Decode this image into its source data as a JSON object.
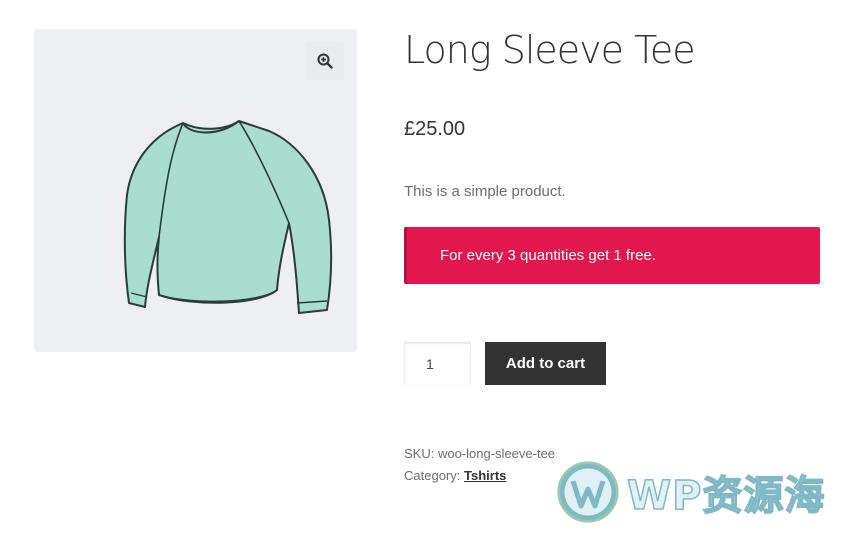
{
  "product": {
    "title": "Long Sleeve Tee",
    "price": "£25.00",
    "description": "This is a simple product.",
    "notice": "For every 3 quantities get 1 free.",
    "quantity": "1",
    "add_to_cart_label": "Add to cart",
    "sku_label": "SKU:",
    "sku_value": "woo-long-sleeve-tee",
    "category_label": "Category:",
    "category_value": "Tshirts",
    "image_icon": "long-sleeve-shirt-icon",
    "zoom_icon": "zoom-in-icon"
  },
  "watermark": {
    "text": "WP资源海",
    "logo_icon": "wordpress-logo-icon"
  },
  "colors": {
    "notice_bg": "#e2174e",
    "button_bg": "#333333",
    "gallery_bg": "#edeff2",
    "shirt_fill": "#a8ddd0"
  }
}
